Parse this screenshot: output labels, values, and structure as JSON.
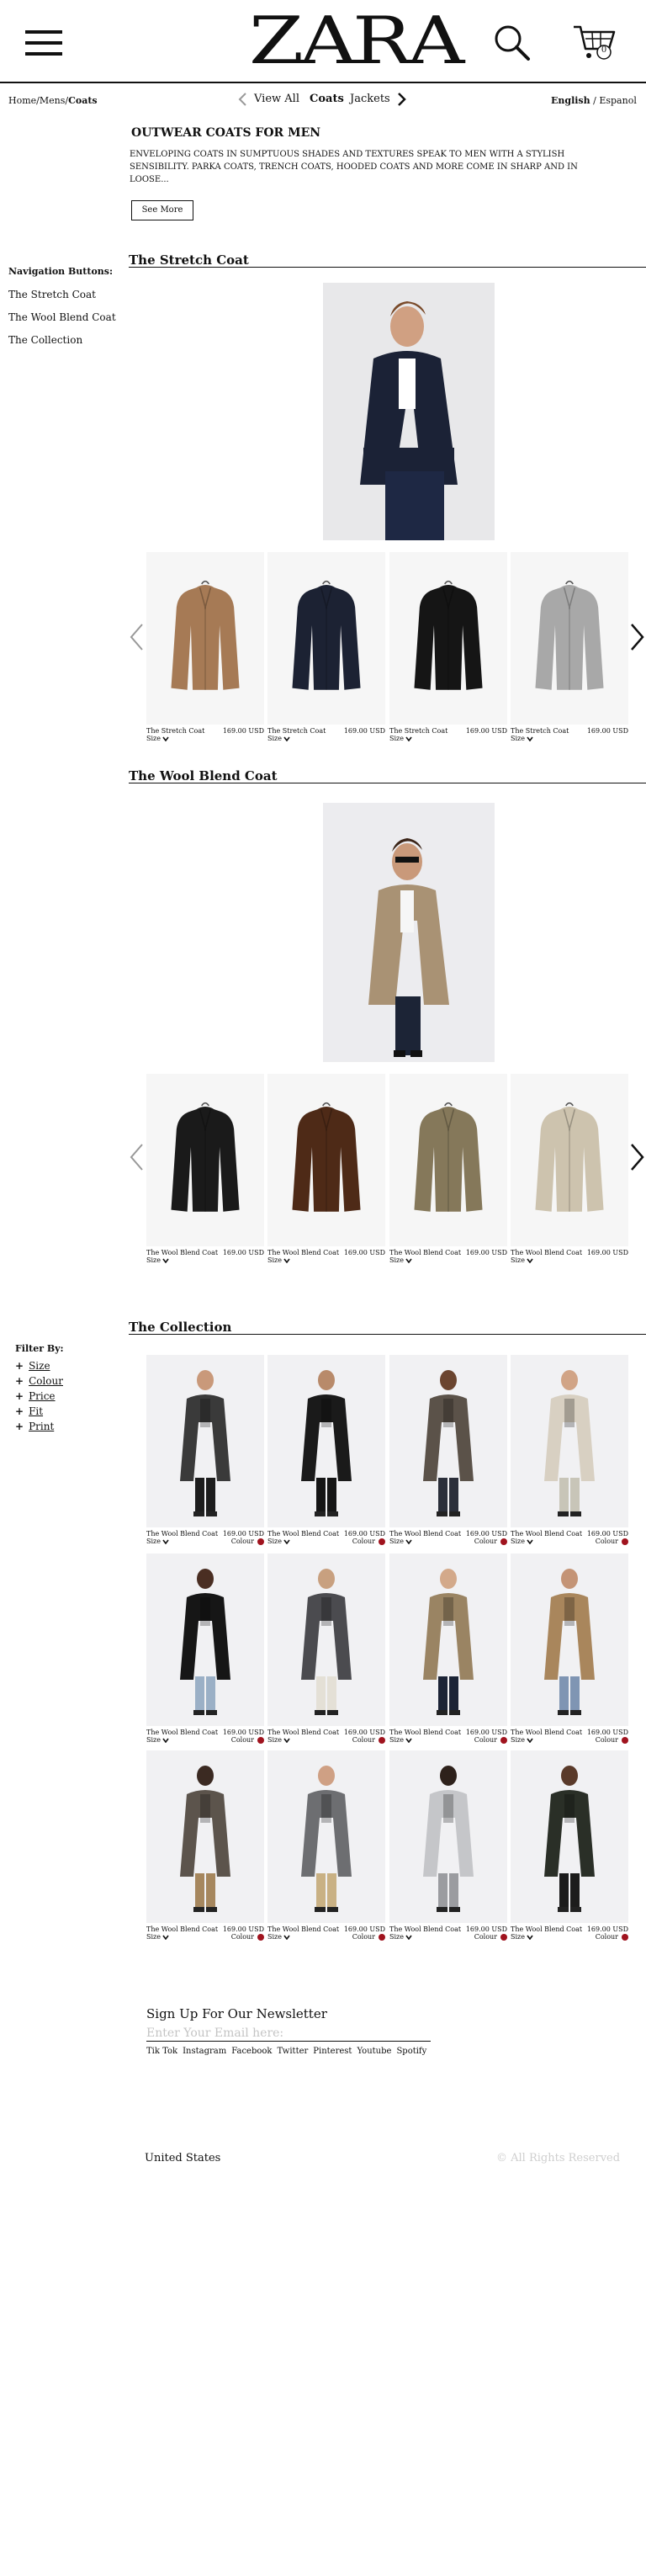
{
  "header": {
    "logo": "ZARA",
    "cart_count": "0"
  },
  "breadcrumb": {
    "home": "Home",
    "mens": "Mens",
    "current": "Coats",
    "sep": "/"
  },
  "category_nav": {
    "view_all": "View All",
    "coats": "Coats",
    "jackets": "Jackets"
  },
  "language": {
    "english": "English",
    "sep": "/",
    "espanol": "Espanol"
  },
  "intro": {
    "title": "OUTWEAR COATS FOR MEN",
    "body": "ENVELOPING COATS IN SUMPTUOUS SHADES AND TEXTURES SPEAK TO MEN WITH A STYLISH SENSIBILITY. PARKA COATS, TRENCH COATS, HOODED COATS AND MORE COME IN SHARP AND IN LOOSE...",
    "see_more": "See More"
  },
  "sidebar_nav": {
    "heading": "Navigation Buttons:",
    "items": [
      "The Stretch Coat",
      "The Wool Blend Coat",
      "The Collection"
    ]
  },
  "stretch": {
    "title": "The Stretch Coat",
    "products": [
      {
        "name": "The Stretch Coat",
        "price": "169.00 USD",
        "size": "Size",
        "color": "#a67a55"
      },
      {
        "name": "The Stretch Coat",
        "price": "169.00 USD",
        "size": "Size",
        "color": "#1c2233"
      },
      {
        "name": "The Stretch Coat",
        "price": "169.00 USD",
        "size": "Size",
        "color": "#151515"
      },
      {
        "name": "The Stretch Coat",
        "price": "169.00 USD",
        "size": "Size",
        "color": "#a8a8a8"
      }
    ]
  },
  "wool": {
    "title": "The Wool Blend Coat",
    "products": [
      {
        "name": "The Wool Blend Coat",
        "price": "169.00 USD",
        "size": "Size",
        "color": "#1a1a1a"
      },
      {
        "name": "The Wool Blend Coat",
        "price": "169.00 USD",
        "size": "Size",
        "color": "#4e2a17"
      },
      {
        "name": "The Wool Blend Coat",
        "price": "169.00 USD",
        "size": "Size",
        "color": "#85785a"
      },
      {
        "name": "The Wool Blend Coat",
        "price": "169.00 USD",
        "size": "Size",
        "color": "#cdc3ae"
      }
    ]
  },
  "filters": {
    "heading": "Filter By:",
    "items": [
      "Size",
      "Colour",
      "Price",
      "Fit",
      "Print"
    ]
  },
  "collection": {
    "title": "The Collection",
    "name": "The Wool Blend Coat",
    "price": "169.00 USD",
    "size": "Size",
    "colour": "Colour",
    "tiles": [
      {
        "coat": "#3a3a3a",
        "pants": "#1d1d1d"
      },
      {
        "coat": "#1a1a1a",
        "pants": "#151515"
      },
      {
        "coat": "#5b5249",
        "pants": "#2b2f3a"
      },
      {
        "coat": "#d8d0c2",
        "pants": "#c8c5b8"
      },
      {
        "coat": "#161616",
        "pants": "#9bb0c6"
      },
      {
        "coat": "#4b4b4f",
        "pants": "#e4e0d6"
      },
      {
        "coat": "#9a8463",
        "pants": "#1c2436"
      },
      {
        "coat": "#a9865c",
        "pants": "#7f95b3"
      },
      {
        "coat": "#5c544c",
        "pants": "#a6875e"
      },
      {
        "coat": "#6d6e71",
        "pants": "#c9b184"
      },
      {
        "coat": "#c5c6c9",
        "pants": "#9b9ca0"
      },
      {
        "coat": "#2a2f27",
        "pants": "#1c1c1c"
      }
    ]
  },
  "newsletter": {
    "title": "Sign Up For Our Newsletter",
    "placeholder": "Enter Your Email here:",
    "social": [
      "Tik Tok",
      "Instagram",
      "Facebook",
      "Twitter",
      "Pinterest",
      "Youtube",
      "Spotify"
    ]
  },
  "footer": {
    "country": "United States",
    "rights": "© All Rights Reserved"
  }
}
